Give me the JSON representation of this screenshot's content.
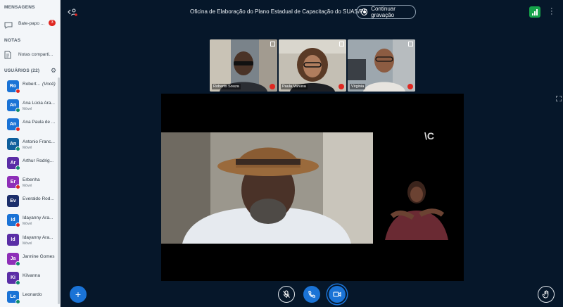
{
  "sidebar": {
    "messages_title": "MENSAGENS",
    "chat_label": "Bate-papo ...",
    "chat_badge": "3",
    "notes_title": "NOTAS",
    "notes_label": "Notas comparti...",
    "users_title": "USUÁRIOS (22)",
    "users": [
      {
        "initials": "Ro",
        "name": "Robert...",
        "you": "(Você)",
        "sub": "",
        "color": "#1a73d6",
        "status": "#df2721"
      },
      {
        "initials": "An",
        "name": "Ana Lúcia Ara...",
        "sub": "Móvel",
        "color": "#1a73d6",
        "status": "#0e8a6b"
      },
      {
        "initials": "An",
        "name": "Ana Paula de ...",
        "sub": "",
        "color": "#1a73d6",
        "status": "#df2721"
      },
      {
        "initials": "An",
        "name": "Antonio Franc...",
        "sub": "Móvel",
        "color": "#0f5f9c",
        "status": "#0e8a6b"
      },
      {
        "initials": "Ar",
        "name": "Arthur Rodrig...",
        "sub": "",
        "color": "#5a2ea6",
        "status": "#0e8a6b"
      },
      {
        "initials": "Er",
        "name": "Erbenha",
        "sub": "Móvel",
        "color": "#8e2fb8",
        "status": "#df2721"
      },
      {
        "initials": "Ev",
        "name": "Everaldo Rod...",
        "sub": "",
        "color": "#1c2f6b",
        "status": ""
      },
      {
        "initials": "Id",
        "name": "Idayanny Ara...",
        "sub": "Móvel",
        "color": "#1a73d6",
        "status": "#df2721"
      },
      {
        "initials": "Id",
        "name": "Idayanny Ara...",
        "sub": "Móvel",
        "color": "#5a2ea6",
        "status": ""
      },
      {
        "initials": "Ja",
        "name": "Jannine Gomes",
        "sub": "",
        "color": "#8e2fb8",
        "status": "#0e8a6b"
      },
      {
        "initials": "Ki",
        "name": "Kilvanna",
        "sub": "",
        "color": "#5a2ea6",
        "status": "#0e8a6b"
      },
      {
        "initials": "Le",
        "name": "Leonardo",
        "sub": "",
        "color": "#1a73d6",
        "status": "#0e8a6b"
      }
    ]
  },
  "topbar": {
    "title": "Oficina de Elaboração do Plano Estadual de Capacitação do SUAS/PE",
    "record_label": "Continuar gravação"
  },
  "thumbs": [
    {
      "name": "Roberto Souza"
    },
    {
      "name": "Paula Vanusa"
    },
    {
      "name": "Virginia"
    }
  ],
  "stage": {
    "logo_text": "\\C"
  }
}
